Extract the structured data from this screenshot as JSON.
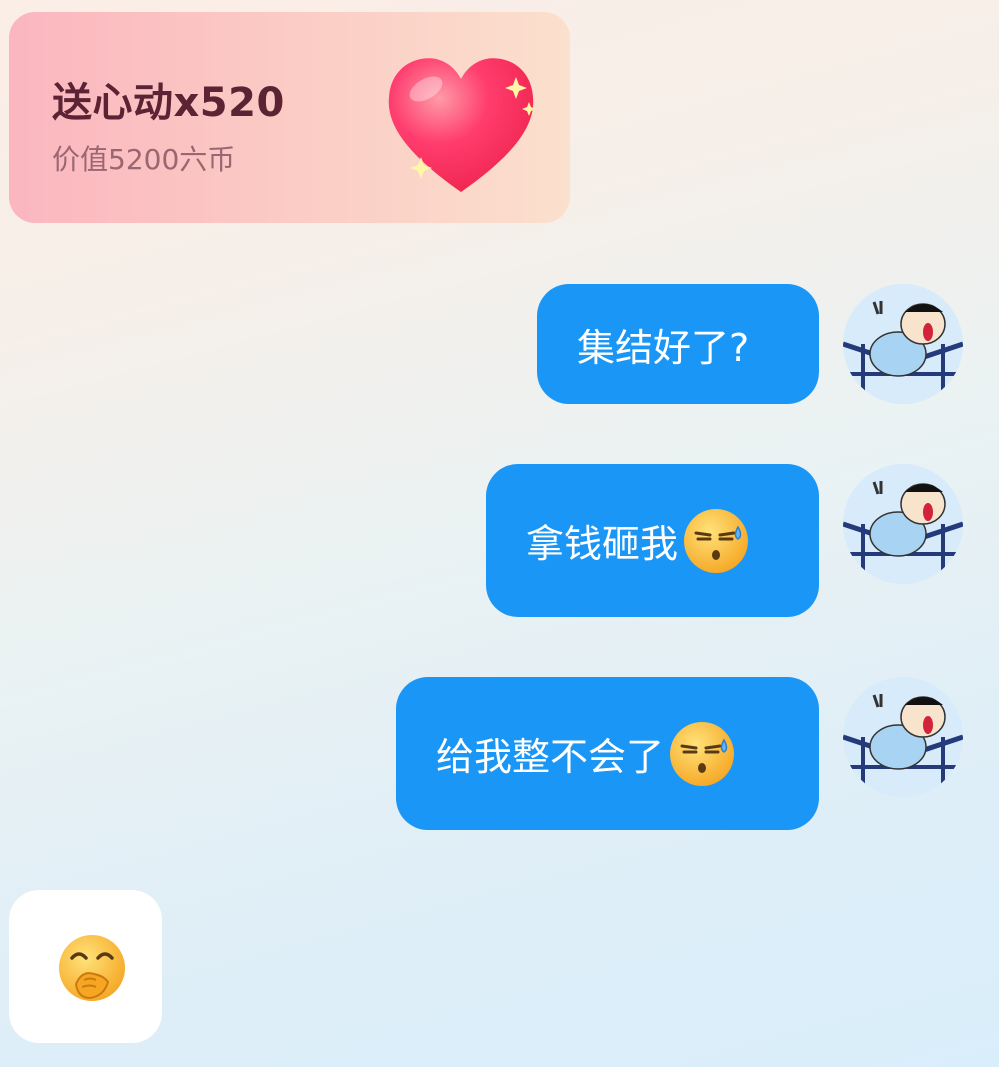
{
  "gift": {
    "title": "送心动x520",
    "subtitle": "价值5200六币",
    "icon": "heart-icon"
  },
  "messages": [
    {
      "text": "集结好了?",
      "emoji": null,
      "sender": "self"
    },
    {
      "text": "拿钱砸我",
      "emoji": "smirk-sweat-emoji",
      "sender": "self"
    },
    {
      "text": "给我整不会了",
      "emoji": "smirk-sweat-emoji",
      "sender": "self"
    }
  ],
  "incoming": {
    "emoji": "giggle-cover-mouth-emoji",
    "sender": "other"
  },
  "colors": {
    "bubble": "#1a96f6",
    "gift_title": "#5b2333",
    "gift_sub": "#9a6671"
  }
}
